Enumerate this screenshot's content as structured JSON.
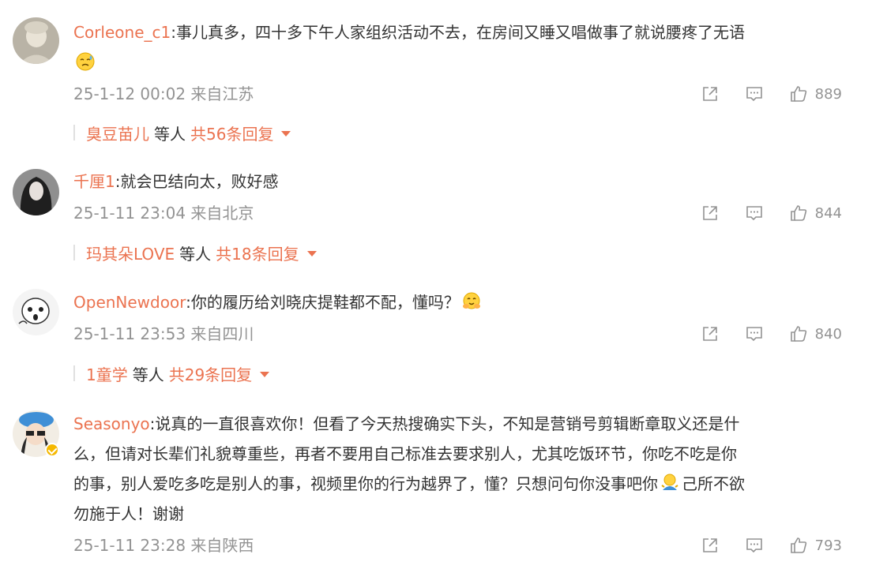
{
  "comments": [
    {
      "username": "Corleone_c1",
      "text": ":事儿真多，四十多下午人家组织活动不去，在房间又睡又唱做事了就说腰疼了无语",
      "time": "25-1-12 00:02",
      "location": "来自江苏",
      "likes": "889",
      "reply_by": "臭豆苗儿",
      "reply_etc": "等人",
      "reply_total": "共56条回复"
    },
    {
      "username": "千厘1",
      "text": ":就会巴结向太，败好感",
      "time": "25-1-11 23:04",
      "location": "来自北京",
      "likes": "844",
      "reply_by": "玛其朵LOVE",
      "reply_etc": "等人",
      "reply_total": "共18条回复"
    },
    {
      "username": "OpenNewdoor",
      "text": ":你的履历给刘晓庆提鞋都不配，懂吗？",
      "time": "25-1-11 23:53",
      "location": "来自四川",
      "likes": "840",
      "reply_by": "1童学",
      "reply_etc": "等人",
      "reply_total": "共29条回复"
    },
    {
      "username": "Seasonyo",
      "text_line1": ":说真的一直很喜欢你！但看了今天热搜确实下头，不知是营销号剪辑断章取义还是什",
      "text_line2": "么，但请对长辈们礼貌尊重些，再者不要用自己标准去要求别人，尤其吃饭环节，你吃不吃是你",
      "text_line3a": "的事，别人爱吃多吃是别人的事，视频里你的行为越界了，懂？只想问句你没事吧你",
      "text_line3b": "己所不欲",
      "text_line4": "勿施于人！谢谢",
      "time": "25-1-11 23:28",
      "location": "来自陕西",
      "likes": "793",
      "verified_badge": "verified-icon"
    }
  ],
  "colors": {
    "username": "#eb7350",
    "body_text": "#333333",
    "meta_text": "#939393",
    "reply_link": "#eb7350"
  },
  "icons": [
    "share-icon",
    "comment-icon",
    "like-icon",
    "caret-down-icon",
    "sweat-emoji",
    "hug-emoji",
    "shrug-emoji"
  ]
}
